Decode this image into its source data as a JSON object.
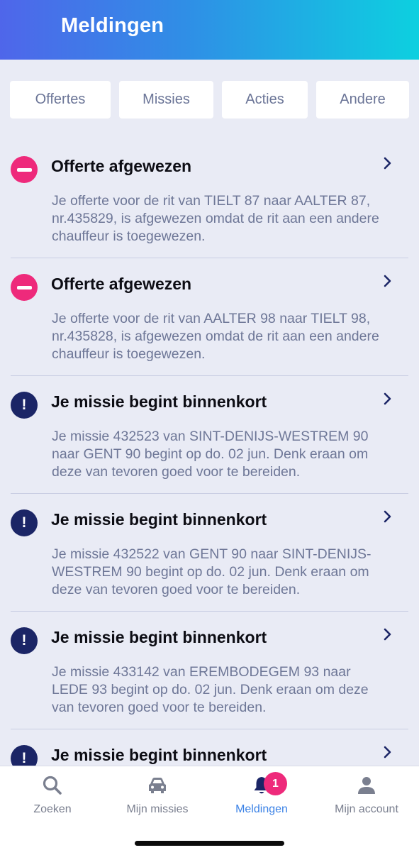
{
  "header": {
    "title": "Meldingen"
  },
  "filters": [
    "Offertes",
    "Missies",
    "Acties",
    "Andere"
  ],
  "notifications": [
    {
      "type": "rejected",
      "icon": "minus-circle-icon",
      "title": "Offerte afgewezen",
      "body": "Je offerte voor de rit van TIELT 87 naar AALTER 87, nr.435829, is afgewezen omdat de rit aan een andere chauffeur is toegewezen."
    },
    {
      "type": "rejected",
      "icon": "minus-circle-icon",
      "title": "Offerte afgewezen",
      "body": "Je offerte voor de rit van AALTER 98 naar TIELT 98, nr.435828, is afgewezen omdat de rit aan een andere chauffeur is toegewezen."
    },
    {
      "type": "info",
      "icon": "exclamation-circle-icon",
      "title": "Je missie begint binnenkort",
      "body": "Je missie 432523 van SINT-DENIJS-WESTREM 90 naar GENT 90 begint op do. 02 jun. Denk eraan om deze van tevoren goed voor te bereiden."
    },
    {
      "type": "info",
      "icon": "exclamation-circle-icon",
      "title": "Je missie begint binnenkort",
      "body": "Je missie 432522 van GENT 90 naar SINT-DENIJS-WESTREM 90 begint op do. 02 jun. Denk eraan om deze van tevoren goed voor te bereiden."
    },
    {
      "type": "info",
      "icon": "exclamation-circle-icon",
      "title": "Je missie begint binnenkort",
      "body": "Je missie 433142 van EREMBODEGEM 93 naar LEDE 93 begint op do. 02 jun. Denk eraan om deze van tevoren goed voor te bereiden."
    },
    {
      "type": "info",
      "icon": "exclamation-circle-icon",
      "title": "Je missie begint binnenkort",
      "body": ""
    }
  ],
  "info_icon_glyph": "!",
  "nav": {
    "items": [
      {
        "label": "Zoeken",
        "icon": "search-icon"
      },
      {
        "label": "Mijn missies",
        "icon": "car-icon"
      },
      {
        "label": "Meldingen",
        "icon": "bell-icon",
        "active": true,
        "badge": "1"
      },
      {
        "label": "Mijn account",
        "icon": "person-icon"
      }
    ]
  },
  "colors": {
    "header_gradient": [
      "#4f66ea",
      "#0dd0e0"
    ],
    "accent_active": "#3b82e6",
    "badge": "#ee2a7b",
    "reject_icon": "#ee2a7b",
    "info_icon": "#1b2566"
  }
}
